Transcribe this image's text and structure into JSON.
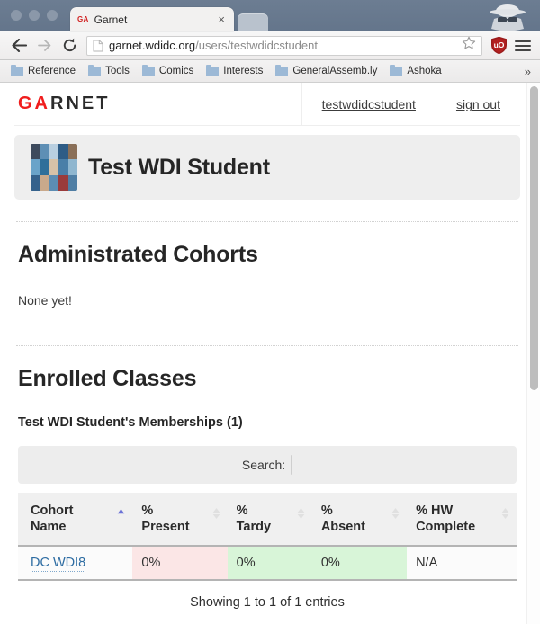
{
  "browser": {
    "tab": {
      "favicon_text": "GA",
      "title": "Garnet",
      "close_label": "×"
    },
    "nav": {
      "back_label": "←",
      "forward_label": "→",
      "reload_label": "⟳",
      "url_host": "garnet.wdidc.org",
      "url_path": "/users/testwdidcstudent",
      "star_icon": "bookmark-star-icon",
      "extension_icon": "ublock-origin-shield-icon",
      "menu_icon": "hamburger-menu-icon",
      "incognito_icon": "incognito-spy-icon"
    },
    "bookmarks": {
      "items": [
        {
          "label": "Reference"
        },
        {
          "label": "Tools"
        },
        {
          "label": "Comics"
        },
        {
          "label": "Interests"
        },
        {
          "label": "GeneralAssemb.ly"
        },
        {
          "label": "Ashoka"
        }
      ],
      "overflow_label": "»"
    }
  },
  "site": {
    "brand_red": "GA",
    "brand_rest": "RNET",
    "brand_red_color": "#f01d1d",
    "nav_links": [
      {
        "label": "testwdidcstudent"
      },
      {
        "label": "sign out"
      }
    ]
  },
  "hero": {
    "title": "Test WDI Student",
    "avatar_name": "user-avatar-photo-collage"
  },
  "sections": {
    "administrated": {
      "heading": "Administrated Cohorts",
      "empty_text": "None yet!"
    },
    "enrolled": {
      "heading": "Enrolled Classes",
      "subheading": "Test WDI Student's Memberships (1)"
    }
  },
  "datatable": {
    "search_label": "Search:",
    "search_value": "",
    "search_placeholder": "",
    "columns": [
      {
        "line1": "Cohort",
        "line2": "Name",
        "sort": "asc"
      },
      {
        "line1": "%",
        "line2": "Present",
        "sort": "none"
      },
      {
        "line1": "%",
        "line2": "Tardy",
        "sort": "none"
      },
      {
        "line1": "%",
        "line2": "Absent",
        "sort": "none"
      },
      {
        "line1": "% HW",
        "line2": "Complete",
        "sort": "none"
      }
    ],
    "rows": [
      {
        "cohort_name": "DC WDI8",
        "present": "0%",
        "tardy": "0%",
        "absent": "0%",
        "hw_complete": "N/A"
      }
    ],
    "info": "Showing 1 to 1 of 1 entries",
    "sort_active_color": "#6b72d6",
    "present_cell_color": "#fbe6e6",
    "tardy_cell_color": "#d8f5d8",
    "absent_cell_color": "#d8f5d8"
  }
}
